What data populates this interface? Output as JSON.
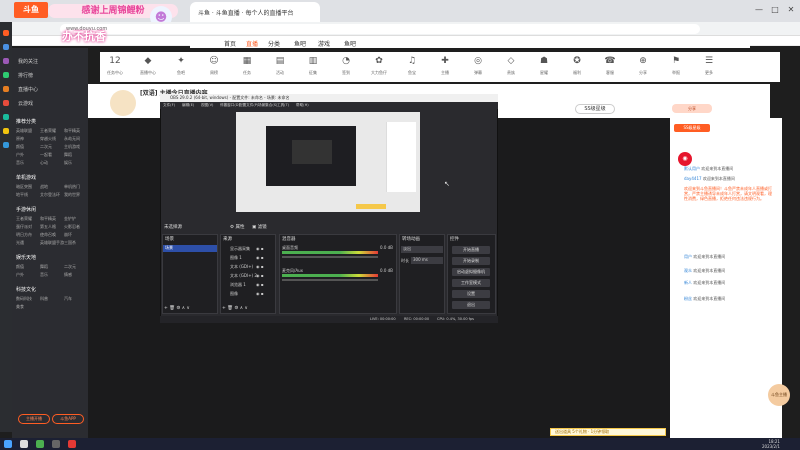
{
  "browser": {
    "tab_title": "斗鱼 · 斗鱼直播 · 每个人的直播平台",
    "address": "www.douyu.com",
    "controls": [
      "—",
      "□",
      "✕"
    ]
  },
  "brand": {
    "logo_text": "斗鱼",
    "logo_sub": "DOUYU.COM",
    "banner": "感谢上周锦鲤粉",
    "banner2": "办不抗香",
    "accent": "#ff5d23"
  },
  "nav": {
    "items": [
      "首页",
      "直播",
      "分类",
      "鱼吧",
      "游戏",
      "鱼吧"
    ],
    "active_index": 1,
    "right_chip": "PC客户端"
  },
  "icons": [
    {
      "glyph": "12",
      "label": "任务中心"
    },
    {
      "glyph": "◆",
      "label": "直播中心"
    },
    {
      "glyph": "✦",
      "label": "鱼吧"
    },
    {
      "glyph": "☺",
      "label": "周榜"
    },
    {
      "glyph": "▦",
      "label": "任务"
    },
    {
      "glyph": "▤",
      "label": "活动"
    },
    {
      "glyph": "▥",
      "label": "征集"
    },
    {
      "glyph": "◔",
      "label": "签到"
    },
    {
      "glyph": "✿",
      "label": "大力鱼仔"
    },
    {
      "glyph": "♫",
      "label": "鱼宝"
    },
    {
      "glyph": "✚",
      "label": "主播"
    },
    {
      "glyph": "◎",
      "label": "弹幕"
    },
    {
      "glyph": "◇",
      "label": "贵族"
    },
    {
      "glyph": "☗",
      "label": "星耀"
    },
    {
      "glyph": "✪",
      "label": "福利"
    },
    {
      "glyph": "☎",
      "label": "客服"
    },
    {
      "glyph": "⊕",
      "label": "分享"
    },
    {
      "glyph": "⚑",
      "label": "举报"
    },
    {
      "glyph": "☰",
      "label": "更多"
    }
  ],
  "sidebar": {
    "top_items": [
      "我的关注",
      "排行榜",
      "直播中心",
      "云游戏"
    ],
    "sections": [
      {
        "title": "推荐分类",
        "cells": [
          "英雄联盟",
          "王者荣耀",
          "和平精英",
          "原神",
          "穿越火线",
          "永劫无间",
          "颜值",
          "二次元",
          "主机游戏",
          "户外",
          "一起看",
          "舞蹈",
          "音乐",
          "心动",
          "娱乐"
        ]
      },
      {
        "title": "单机游戏",
        "cells": [
          "暗区突围",
          "战地",
          "单机热门",
          "地平线",
          "艾尔登法环",
          "我的世界"
        ]
      },
      {
        "title": "手游休闲",
        "cells": [
          "王者荣耀",
          "和平精英",
          "金铲铲",
          "蛋仔派对",
          "第五人格",
          "火影忍者",
          "明日方舟",
          "使命召唤",
          "崩坏",
          "光遇",
          "英雄联盟手游",
          "三国杀"
        ]
      },
      {
        "title": "娱乐天地",
        "cells": [
          "颜值",
          "舞蹈",
          "二次元",
          "户外",
          "音乐",
          "情感"
        ]
      },
      {
        "title": "科技文化",
        "cells": [
          "数码科技",
          "科普",
          "汽车",
          "美食"
        ]
      }
    ],
    "bottom_buttons": [
      "主播开播",
      "斗鱼APP"
    ]
  },
  "room": {
    "title": "[双语] 主播今日直播内容",
    "follow": "关注",
    "anchor_chip": "分享",
    "level_chip": "SS级星级"
  },
  "obs": {
    "title": "OBS 29.0.2 (64-bit, windows) - 配置文件: 未命名 - 场景: 未命名",
    "menu": [
      "文件(F)",
      "编辑(E)",
      "视图(V)",
      "停靠窗口(D)",
      "配置文件(P)",
      "场景集合(S)",
      "工具(T)",
      "帮助(H)"
    ],
    "toolbar_left": "未选择源",
    "toolbar_buttons": [
      "属性",
      "滤镜"
    ],
    "panels": {
      "scenes": {
        "title": "场景",
        "items": [
          "场景"
        ]
      },
      "sources": {
        "title": "来源",
        "items": [
          "显示器采集",
          "图像 1",
          "文本 (GDI+)",
          "文本 (GDI+) 2",
          "浏览器 1",
          "图像"
        ]
      },
      "mixer": {
        "title": "混音器",
        "items": [
          "桌面音频",
          "麦克风/Aux"
        ],
        "level": "0.0 dB"
      },
      "transitions": {
        "title": "转场动画",
        "type": "淡出",
        "duration_label": "时长",
        "duration": "300 ms"
      },
      "controls": {
        "title": "控件",
        "buttons": [
          "开始直播",
          "开始录制",
          "启动虚拟摄像机",
          "工作室模式",
          "设置",
          "退出"
        ]
      }
    },
    "status": [
      "LIVE: 00:00:00",
      "REC: 00:00:00",
      "CPU: 0.4%, 30.00 fps"
    ]
  },
  "chat": {
    "notice": "欢迎来到斗鱼直播间！斗鱼严禁未成年人直播或打赏，严禁主播诱导未成年人打赏，请文明观看，理性消费，绿色直播，拒绝任何违法违规行为。",
    "lines": [
      {
        "name": "默认用户",
        "text": "欢迎来到本直播间"
      },
      {
        "name": "day4417",
        "text": "欢迎来到本直播间"
      },
      {
        "name": "用户",
        "text": "欢迎来到本直播间"
      },
      {
        "name": "观众",
        "text": "欢迎来到本直播间"
      },
      {
        "name": "新人",
        "text": "欢迎来到本直播间"
      },
      {
        "name": "粉丝",
        "text": "欢迎来到本直播间"
      }
    ],
    "gift_bar": "送出道具 5个礼物 · 1分钟领取",
    "mascot": "斗鱼主播"
  },
  "taskbar": {
    "time": "18:21",
    "date": "2023/2/1"
  }
}
